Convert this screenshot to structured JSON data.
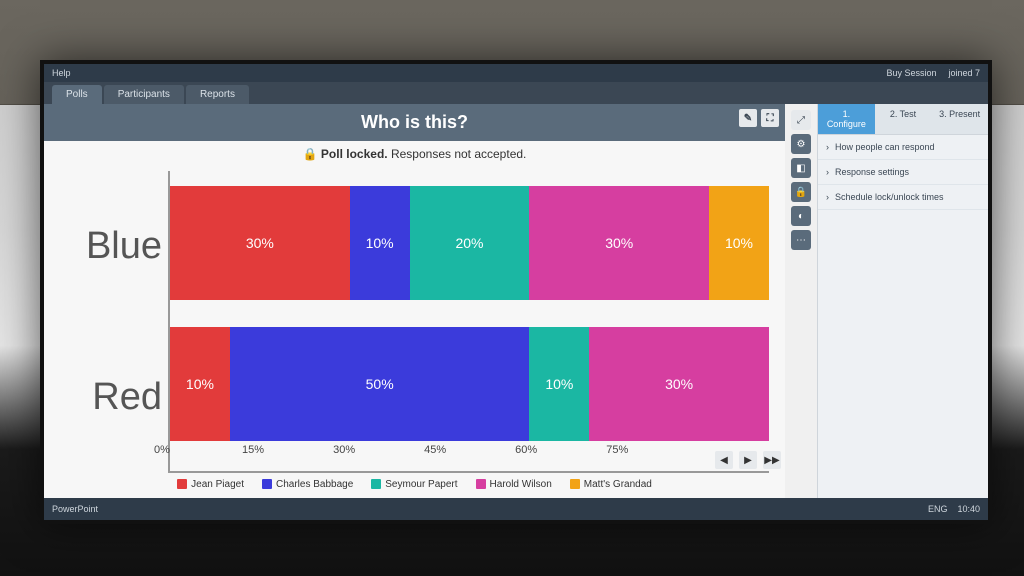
{
  "topbar": {
    "left": [
      "Help"
    ],
    "right": [
      "Buy Session",
      "joined 7"
    ]
  },
  "tabs": {
    "items": [
      "Polls",
      "Participants",
      "Reports"
    ],
    "active": 0
  },
  "title": "Who is this?",
  "lock": {
    "icon": "lock",
    "label_bold": "Poll locked.",
    "label_rest": "Responses not accepted."
  },
  "sidepanel": {
    "tabs": [
      "1. Configure",
      "2. Test",
      "3. Present"
    ],
    "active": 0,
    "items": [
      "How people can respond",
      "Response settings",
      "Schedule lock/unlock times"
    ]
  },
  "vtoolbar": [
    "expand",
    "settings",
    "visual",
    "lock",
    "hide",
    "more"
  ],
  "legend": [
    {
      "name": "Jean Piaget",
      "color": "#e23b3b"
    },
    {
      "name": "Charles Babbage",
      "color": "#3b3bdb"
    },
    {
      "name": "Seymour Papert",
      "color": "#1bb7a3"
    },
    {
      "name": "Harold Wilson",
      "color": "#d63ea0"
    },
    {
      "name": "Matt's Grandad",
      "color": "#f2a316"
    }
  ],
  "xaxis": [
    "0%",
    "15%",
    "30%",
    "45%",
    "60%",
    "75%"
  ],
  "playctrl": [
    "prev",
    "play",
    "next"
  ],
  "bottom": {
    "left": [
      "PowerPoint"
    ],
    "right": [
      "ENG",
      "10:40"
    ]
  },
  "chart_data": {
    "type": "bar",
    "orientation": "horizontal-stacked",
    "title": "Who is this?",
    "xlabel": "",
    "ylabel": "",
    "xlim": [
      0,
      100
    ],
    "x_ticks": [
      0,
      15,
      30,
      45,
      60,
      75
    ],
    "categories": [
      "Blue",
      "Red"
    ],
    "series": [
      {
        "name": "Jean Piaget",
        "color": "#e23b3b",
        "values": [
          30,
          10
        ]
      },
      {
        "name": "Charles Babbage",
        "color": "#3b3bdb",
        "values": [
          10,
          50
        ]
      },
      {
        "name": "Seymour Papert",
        "color": "#1bb7a3",
        "values": [
          20,
          10
        ]
      },
      {
        "name": "Harold Wilson",
        "color": "#d63ea0",
        "values": [
          30,
          30
        ]
      },
      {
        "name": "Matt's Grandad",
        "color": "#f2a316",
        "values": [
          10,
          0
        ]
      }
    ]
  }
}
